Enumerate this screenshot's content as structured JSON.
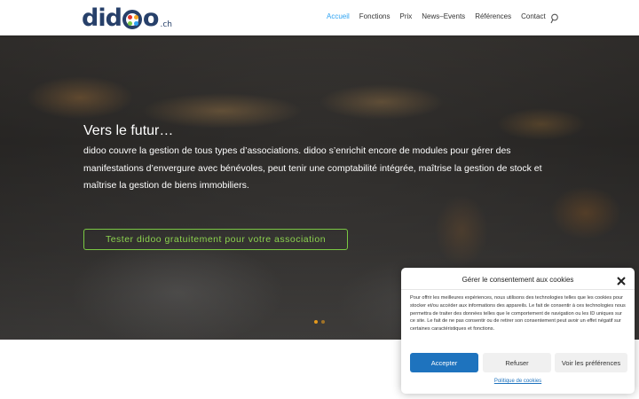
{
  "logo": {
    "word_start": "did",
    "word_end": "o",
    "tld": ".ch",
    "color": "#27406a"
  },
  "nav": {
    "items": [
      "Accueil",
      "Fonctions",
      "Prix",
      "News–Events",
      "Références",
      "Contact"
    ],
    "active_color": "#2ea3f2",
    "search_icon": "search-icon"
  },
  "hero": {
    "title": "Vers le futur…",
    "text": "didoo couvre la gestion de tous types d’associations. didoo s’enrichit encore de modules pour gérer des manifestations d’envergure avec bénévoles, peut tenir une comptabilité intégrée, maîtrise la gestion de stock et maîtrise la gestion de biens immobiliers.",
    "cta_label": "Tester didoo gratuitement pour votre association",
    "cta_color": "#7ac943",
    "slide_dots": 2,
    "active_slide": 1
  },
  "cookie": {
    "title": "Gérer le consentement aux cookies",
    "close_icon": "close-icon",
    "body": "Pour offrir les meilleures expériences, nous utilisons des technologies telles que les cookies pour stocker et/ou accéder aux informations des appareils. Le fait de consentir à ces technologies nous permettra de traiter des données telles que le comportement de navigation ou les ID uniques sur ce site. Le fait de ne pas consentir ou de retirer son consentement peut avoir un effet négatif sur certaines caractéristiques et fonctions.",
    "accept_label": "Accepter",
    "refuse_label": "Refuser",
    "prefs_label": "Voir les préférences",
    "policy_link": "Politique de cookies",
    "accent_color": "#1e73be"
  }
}
